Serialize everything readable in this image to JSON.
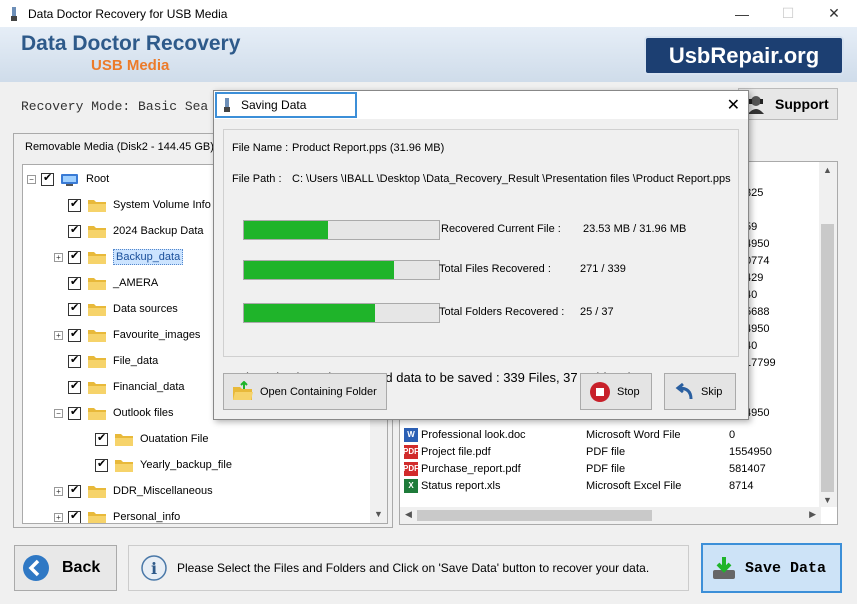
{
  "window": {
    "title": "Data Doctor Recovery for USB Media",
    "minimize": "—",
    "maximize": "☐",
    "close": "✕"
  },
  "banner": {
    "brand_line1": "Data Doctor Recovery",
    "brand_line2": "USB Media",
    "site": "UsbRepair.org"
  },
  "toolbar": {
    "mode_text": "Recovery Mode: Basic Sea",
    "support_label": "Support"
  },
  "left_panel": {
    "media_label": "Removable Media (Disk2 - 144.45 GB)",
    "tree": [
      {
        "label": "Root",
        "level": 0,
        "expand": "−"
      },
      {
        "label": "System Volume Info",
        "level": 1,
        "expand": ""
      },
      {
        "label": "2024 Backup Data",
        "level": 1,
        "expand": ""
      },
      {
        "label": "Backup_data",
        "level": 1,
        "expand": "+",
        "selected": true
      },
      {
        "label": "_AMERA",
        "level": 1,
        "expand": ""
      },
      {
        "label": "Data sources",
        "level": 1,
        "expand": ""
      },
      {
        "label": "Favourite_images",
        "level": 1,
        "expand": "+"
      },
      {
        "label": "File_data",
        "level": 1,
        "expand": ""
      },
      {
        "label": "Financial_data",
        "level": 1,
        "expand": ""
      },
      {
        "label": "Outlook files",
        "level": 1,
        "expand": "−"
      },
      {
        "label": "Ouatation File",
        "level": 2,
        "expand": ""
      },
      {
        "label": "Yearly_backup_file",
        "level": 2,
        "expand": ""
      },
      {
        "label": "DDR_Miscellaneous",
        "level": 1,
        "expand": "+"
      },
      {
        "label": "Personal_info",
        "level": 1,
        "expand": "+"
      }
    ]
  },
  "right_panel": {
    "partial_sizes": [
      "825",
      "59",
      "4950",
      "0774",
      "429",
      "40",
      "5688",
      "4950",
      "40",
      "17799",
      "4950"
    ],
    "files": [
      {
        "name": "Professional look.doc",
        "type": "Microsoft Word File",
        "size": "0",
        "icon": "word-icon"
      },
      {
        "name": "Project file.pdf",
        "type": "PDF file",
        "size": "1554950",
        "icon": "pdf-icon"
      },
      {
        "name": "Purchase_report.pdf",
        "type": "PDF file",
        "size": "581407",
        "icon": "pdf-icon"
      },
      {
        "name": "Status report.xls",
        "type": "Microsoft Excel File",
        "size": "8714",
        "icon": "excel-icon"
      }
    ]
  },
  "dialog": {
    "title": "Saving Data",
    "close": "✕",
    "file_name_label": "File Name :",
    "file_name": "Product Report.pps (31.96 MB)",
    "file_path_label": "File Path  :",
    "file_path": "C: \\Users \\IBALL \\Desktop \\Data_Recovery_Result \\Presentation files \\Product Report.pps",
    "progress": [
      {
        "label": "Recovered Current File :",
        "value": "23.53 MB /  31.96 MB",
        "fraction": 0.43
      },
      {
        "label": "Total Files Recovered :",
        "value": "271 / 339",
        "fraction": 0.77
      },
      {
        "label": "Total Folders Recovered :",
        "value": "25 / 37",
        "fraction": 0.67
      }
    ],
    "summary": "( Total selected recovered data to be saved : 339 Files, 37 Folders )",
    "open_folder_label": "Open Containing Folder",
    "stop_label": "Stop",
    "skip_label": "Skip"
  },
  "bottom": {
    "back_label": "Back",
    "info_text": "Please Select the Files and Folders and Click on 'Save Data' button to recover your data.",
    "save_label": "Save Data"
  },
  "colors": {
    "accent": "#3c8fd8",
    "progress": "#1fb42a",
    "brand_blue": "#2e5a8a",
    "brand_orange": "#ec7b2a",
    "site_bg": "#1c3f72"
  }
}
